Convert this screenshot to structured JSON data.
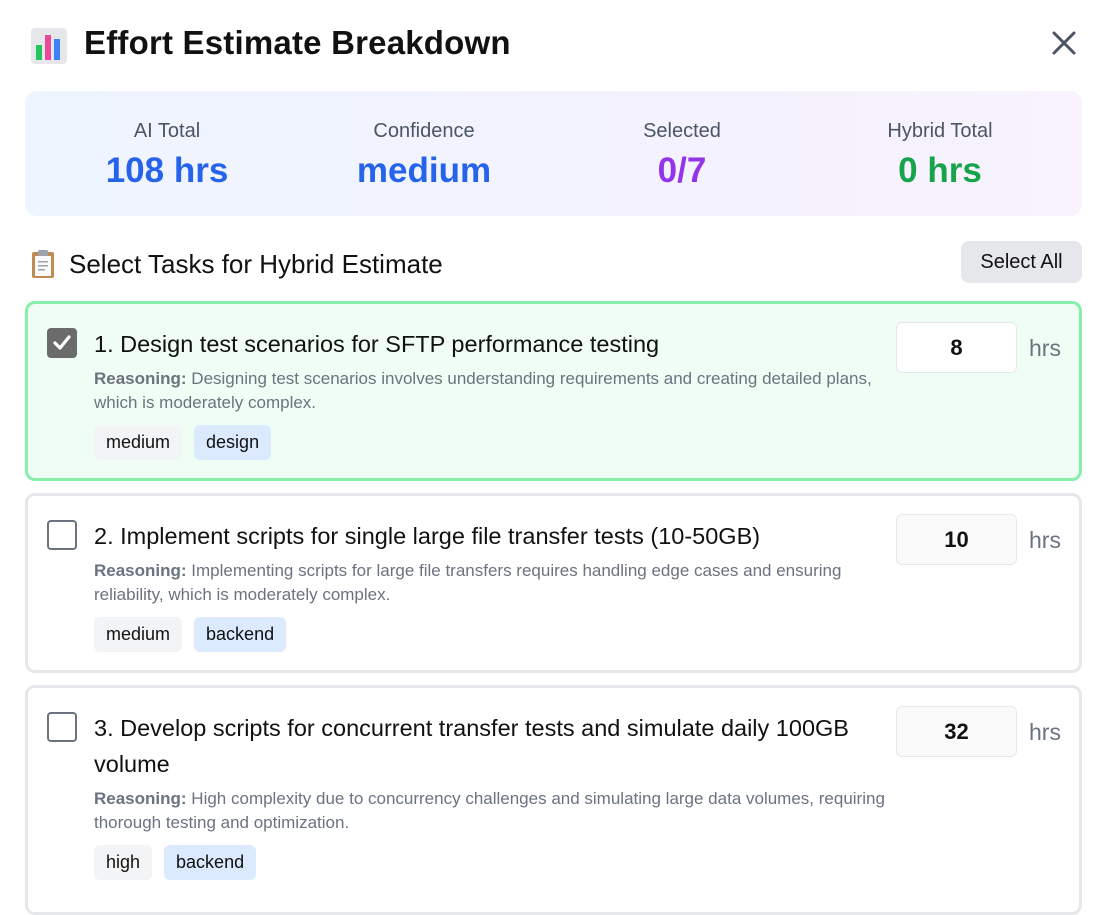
{
  "header": {
    "icon": "bar-chart-icon",
    "title": "Effort Estimate Breakdown",
    "close_icon": "close-icon"
  },
  "summary": {
    "ai_total": {
      "label": "AI Total",
      "value": "108 hrs",
      "color": "#2563eb"
    },
    "confidence": {
      "label": "Confidence",
      "value": "medium",
      "color": "#2563eb"
    },
    "selected": {
      "label": "Selected",
      "value": "0/7",
      "color": "#9333ea"
    },
    "hybrid_total": {
      "label": "Hybrid Total",
      "value": "0 hrs",
      "color": "#16a34a"
    }
  },
  "section": {
    "icon": "clipboard-icon",
    "title": "Select Tasks for Hybrid Estimate",
    "select_all_label": "Select All"
  },
  "tasks": [
    {
      "title": "1. Design test scenarios for SFTP performance testing",
      "reasoning_label": "Reasoning:",
      "reasoning": "Designing test scenarios involves understanding requirements and creating detailed plans, which is moderately complex.",
      "tags": [
        "medium",
        "design"
      ],
      "hours": "8",
      "unit": "hrs",
      "checked": true
    },
    {
      "title": "2. Implement scripts for single large file transfer tests (10-50GB)",
      "reasoning_label": "Reasoning:",
      "reasoning": "Implementing scripts for large file transfers requires handling edge cases and ensuring reliability, which is moderately complex.",
      "tags": [
        "medium",
        "backend"
      ],
      "hours": "10",
      "unit": "hrs",
      "checked": false
    },
    {
      "title": "3. Develop scripts for concurrent transfer tests and simulate daily 100GB volume",
      "reasoning_label": "Reasoning:",
      "reasoning": "High complexity due to concurrency challenges and simulating large data volumes, requiring thorough testing and optimization.",
      "tags": [
        "high",
        "backend"
      ],
      "hours": "32",
      "unit": "hrs",
      "checked": false
    }
  ]
}
